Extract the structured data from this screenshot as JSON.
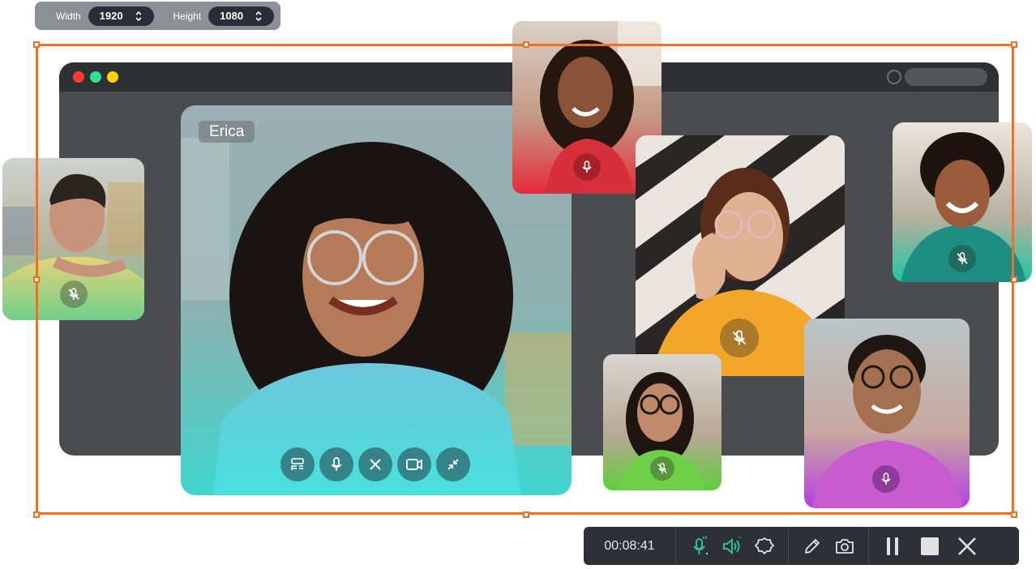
{
  "size_bar": {
    "width_label": "Width",
    "width_value": "1920",
    "height_label": "Height",
    "height_value": "1080"
  },
  "browser": {
    "dots": [
      "#ff3b30",
      "#2ee08f",
      "#ffd400"
    ]
  },
  "main_tile": {
    "name": "Erica",
    "controls": [
      "layout-icon",
      "microphone-icon",
      "close-icon",
      "camera-icon",
      "minimize-icon"
    ]
  },
  "recorder": {
    "timer": "00:08:41",
    "accent_color": "#2ec08f"
  },
  "colors": {
    "capture_frame": "#f37021",
    "toolbar_bg": "#2e3038"
  }
}
